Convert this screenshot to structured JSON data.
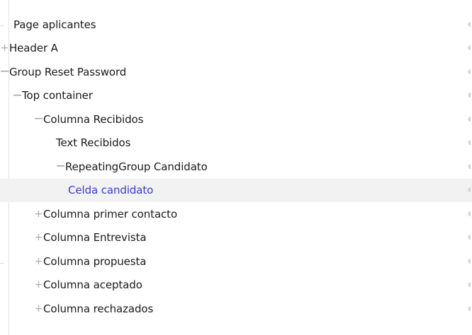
{
  "tree": {
    "items": [
      {
        "label": "Page aplicantes",
        "toggle": "",
        "level": "0n",
        "selected": false
      },
      {
        "label": "Header A",
        "toggle": "+",
        "level": "0",
        "selected": false
      },
      {
        "label": "Group Reset Password",
        "toggle": "−",
        "level": "0",
        "selected": false
      },
      {
        "label": "Top container",
        "toggle": "−",
        "level": "1",
        "selected": false
      },
      {
        "label": "Columna Recibidos",
        "toggle": "−",
        "level": "2",
        "selected": false
      },
      {
        "label": "Text Recibidos",
        "toggle": "",
        "level": "2n",
        "selected": false
      },
      {
        "label": "RepeatingGroup Candidato",
        "toggle": "−",
        "level": "3",
        "selected": false
      },
      {
        "label": "Celda candidato",
        "toggle": "",
        "level": "3n",
        "selected": true
      },
      {
        "label": "Columna primer contacto",
        "toggle": "+",
        "level": "2",
        "selected": false
      },
      {
        "label": "Columna Entrevista",
        "toggle": "+",
        "level": "2",
        "selected": false
      },
      {
        "label": "Columna propuesta",
        "toggle": "+",
        "level": "2",
        "selected": false
      },
      {
        "label": "Columna aceptado",
        "toggle": "+",
        "level": "2",
        "selected": false
      },
      {
        "label": "Columna rechazados",
        "toggle": "+",
        "level": "2",
        "selected": false
      }
    ]
  },
  "icons": {
    "expand": "plus-icon",
    "collapse": "minus-icon",
    "visibility": "eye-icon"
  },
  "colors": {
    "selected_text": "#3a3ac9",
    "selected_row_bg": "#f2f2f2",
    "toggle": "#a9a9a9"
  }
}
